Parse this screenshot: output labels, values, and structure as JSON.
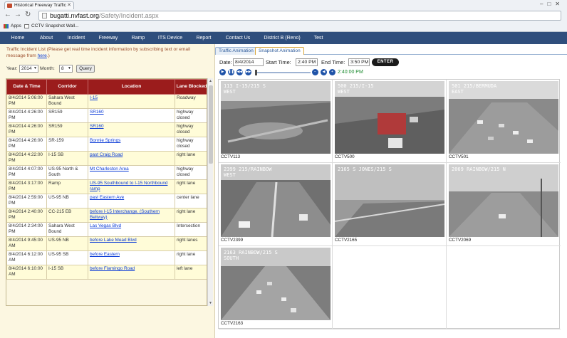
{
  "browser": {
    "tab_title": "Historical Freeway Traffic",
    "url_host": "bugatti.nvfast.org",
    "url_path": "/Safety/Incident.aspx",
    "bookmarks": [
      "Apps",
      "CCTV Snapshot Wall..."
    ]
  },
  "nav": {
    "items": [
      "Home",
      "About",
      "Incident",
      "Freeway",
      "Ramp",
      "ITS Device",
      "Report",
      "Contact Us",
      "District B (Reno)",
      "Test"
    ]
  },
  "incidents": {
    "intro_text": "Traffic Incident List (Please get real time incident information by subscribing text or email message from",
    "intro_link": "here",
    "intro_end": ".)",
    "year_label": "Year:",
    "year_value": "2014",
    "month_label": "Month:",
    "month_value": "8",
    "query_button": "Query",
    "columns": [
      "Date & Time",
      "Corridor",
      "Location",
      "Lane Blocked"
    ],
    "rows": [
      {
        "datetime": "8/4/2014 5:06:00 PM",
        "corridor": "Sahara West Bound",
        "location": "I-15",
        "lane": "Roadway"
      },
      {
        "datetime": "8/4/2014 4:26:00 PM",
        "corridor": "SR159",
        "location": "SR160",
        "lane": "highway closed"
      },
      {
        "datetime": "8/4/2014 4:26:00 PM",
        "corridor": "SR159",
        "location": "SR160",
        "lane": "highway closed"
      },
      {
        "datetime": "8/4/2014 4:26:00 PM",
        "corridor": "SR-159",
        "location": "Bonnie Springs",
        "lane": "highway closed"
      },
      {
        "datetime": "8/4/2014 4:22:00 PM",
        "corridor": "I-15 SB",
        "location": "past Craig Road",
        "lane": "right lane"
      },
      {
        "datetime": "8/4/2014 4:07:00 PM",
        "corridor": "US-95 North & South",
        "location": "Mt Charleston Area",
        "lane": "highway closed"
      },
      {
        "datetime": "8/4/2014 3:17:00 PM",
        "corridor": "Ramp",
        "location": "US-95 Southbound to I-15 Northbound ramp",
        "lane": "right lane"
      },
      {
        "datetime": "8/4/2014 2:59:00 PM",
        "corridor": "US-95 NB",
        "location": "past Eastern Ave",
        "lane": "center lane"
      },
      {
        "datetime": "8/4/2014 2:40:00 PM",
        "corridor": "CC-215 EB",
        "location": "before I-15 Interchange. (Southern Beltway)",
        "lane": "right lane"
      },
      {
        "datetime": "8/4/2014 2:34:00 PM",
        "corridor": "Sahara West Bound",
        "location": "Las Vegas Blvd",
        "lane": "Intersection"
      },
      {
        "datetime": "8/4/2014 9:45:00 AM",
        "corridor": "US-95 NB",
        "location": "before Lake Mead Blvd",
        "lane": "right lanes"
      },
      {
        "datetime": "8/4/2014 6:12:00 AM",
        "corridor": "US-95 SB",
        "location": "before Eastern",
        "lane": "right lane"
      },
      {
        "datetime": "8/4/2014 6:10:00 AM",
        "corridor": "I-15 SB",
        "location": "before Flamingo Road",
        "lane": "left lane"
      }
    ]
  },
  "snapshot": {
    "tabs": [
      "Traffic Animation",
      "Snapshot Animation"
    ],
    "date_label": "Date:",
    "date_value": "8/4/2014",
    "start_label": "Start Time:",
    "start_value": "2:40 PM",
    "end_label": "End Time:",
    "end_value": "3:50 PM",
    "enter_button": "ENTER",
    "current_time": "2:40:00 PM",
    "cameras": [
      {
        "id": "CCTV113",
        "overlay": "113 I-15/215 S",
        "overlay2": "WEST"
      },
      {
        "id": "CCTV500",
        "overlay": "500 215/I-15",
        "overlay2": "WEST"
      },
      {
        "id": "CCTV501",
        "overlay": "501 215/BERMUDA",
        "overlay2": "EAST"
      },
      {
        "id": "CCTV2399",
        "overlay": "2399 215/RAINBOW",
        "overlay2": "WEST"
      },
      {
        "id": "CCTV2165",
        "overlay": "2165 S JONES/215 S",
        "overlay2": ""
      },
      {
        "id": "CCTV2069",
        "overlay": "2069 RAINBOW/215 N",
        "overlay2": ""
      },
      {
        "id": "CCTV2163",
        "overlay": "2163 RAINBOW/215 S",
        "overlay2": "SOUTH"
      }
    ]
  }
}
